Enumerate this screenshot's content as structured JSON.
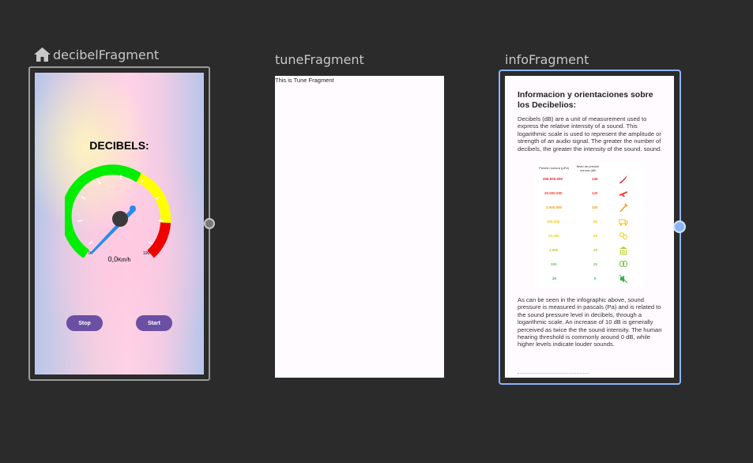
{
  "fragments": {
    "decibel": {
      "title": "decibelFragment",
      "heading": "DECIBELS:",
      "gauge_min": "0",
      "gauge_max": "100",
      "reading": "0,0",
      "reading_unit": "Km/h",
      "stop_label": "Stop",
      "start_label": "Start"
    },
    "tune": {
      "title": "tuneFragment",
      "body_text": "This is Tune Fragment"
    },
    "info": {
      "title": "infoFragment",
      "heading": "Informacion y orientaciones sobre los Decibelios:",
      "para1": "Decibels (dB) are a unit of measurement used to express the relative intensity of a sound. This logarithmic scale is used to represent the amplitude or strength of an audio signal. The greater the number of decibels, the greater the intensity of the sound. sound.",
      "infographic": {
        "col1_header": "Presión sonora (µPa)",
        "col2_header": "Nivel de presión sonora (dB",
        "rows": [
          {
            "pressure": "200.000.000",
            "level": "140",
            "color": "#e0253a",
            "icon": "rocket-icon"
          },
          {
            "pressure": "20.000.000",
            "level": "120",
            "color": "#ef3d2f",
            "icon": "airplane-icon"
          },
          {
            "pressure": "2.000.000",
            "level": "100",
            "color": "#f39a1e",
            "icon": "jackhammer-icon"
          },
          {
            "pressure": "200.000",
            "level": "80",
            "color": "#f5c518",
            "icon": "truck-icon"
          },
          {
            "pressure": "20.000",
            "level": "60",
            "color": "#e4d01c",
            "icon": "conversation-icon"
          },
          {
            "pressure": "2.000",
            "level": "40",
            "color": "#b5cf2a",
            "icon": "library-icon"
          },
          {
            "pressure": "200",
            "level": "20",
            "color": "#6cc04a",
            "icon": "leaves-icon"
          },
          {
            "pressure": "20",
            "level": "0",
            "color": "#3bb04f",
            "icon": "mute-icon"
          }
        ]
      },
      "para2": "As can be seen in the infographic above, sound pressure is measured in pascals (Pa) and is related to the sound pressure level in decibels, through a logarithmic scale. An increase of 10 dB is generally perceived as twice the the sound intensity. The human hearing threshold is commonly around 0 dB, while higher levels indicate louder sounds."
    }
  },
  "colors": {
    "canvas": "#2b2b2c",
    "selection": "#8ab4f8",
    "gauge_green": "#00ee00",
    "gauge_yellow": "#ffff00",
    "gauge_red": "#ee0000",
    "needle": "#2b8be8",
    "button": "#6a4fa3"
  }
}
